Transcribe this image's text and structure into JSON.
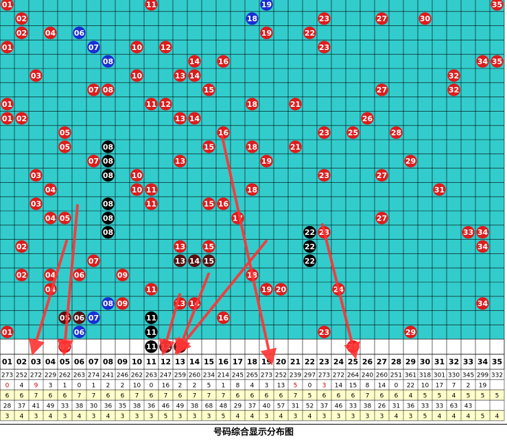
{
  "caption": "号码综合显示分布图",
  "colors": {
    "grid_bg": "#33cccc",
    "grid_line": "#000000",
    "hit_red": "#dd1c1c",
    "hit_blue": "#1a2fd0",
    "hit_black": "#000000",
    "hit_darkred": "#5a1010",
    "arrow": "#ff3333",
    "row_yellow": "#ffffcc",
    "row_white": "#ffffff"
  },
  "chart_data": {
    "type": "table",
    "columns": [
      "01",
      "02",
      "03",
      "04",
      "05",
      "06",
      "07",
      "08",
      "09",
      "10",
      "11",
      "12",
      "13",
      "14",
      "15",
      "16",
      "17",
      "18",
      "19",
      "20",
      "21",
      "22",
      "23",
      "24",
      "25",
      "26",
      "27",
      "28",
      "29",
      "30",
      "31",
      "32",
      "33",
      "34",
      "35"
    ],
    "hits": [
      [
        [
          1,
          "r"
        ],
        [
          11,
          "r"
        ],
        [
          19,
          "b"
        ],
        [
          35,
          "r"
        ]
      ],
      [
        [
          2,
          "r"
        ],
        [
          18,
          "b"
        ],
        [
          23,
          "r"
        ],
        [
          27,
          "r"
        ],
        [
          30,
          "r"
        ]
      ],
      [
        [
          2,
          "r"
        ],
        [
          4,
          "r"
        ],
        [
          6,
          "b"
        ],
        [
          19,
          "r"
        ],
        [
          22,
          "r"
        ]
      ],
      [
        [
          1,
          "r"
        ],
        [
          7,
          "b"
        ],
        [
          10,
          "r"
        ],
        [
          12,
          "r"
        ],
        [
          23,
          "r"
        ]
      ],
      [
        [
          8,
          "b"
        ],
        [
          14,
          "r"
        ],
        [
          16,
          "r"
        ],
        [
          34,
          "r"
        ],
        [
          35,
          "r"
        ]
      ],
      [
        [
          3,
          "r"
        ],
        [
          10,
          "r"
        ],
        [
          13,
          "r"
        ],
        [
          14,
          "r"
        ],
        [
          32,
          "r"
        ]
      ],
      [
        [
          7,
          "r"
        ],
        [
          8,
          "r"
        ],
        [
          15,
          "r"
        ],
        [
          27,
          "r"
        ],
        [
          32,
          "r"
        ]
      ],
      [
        [
          1,
          "r"
        ],
        [
          11,
          "r"
        ],
        [
          12,
          "r"
        ],
        [
          18,
          "r"
        ],
        [
          21,
          "r"
        ]
      ],
      [
        [
          1,
          "r"
        ],
        [
          2,
          "r"
        ],
        [
          13,
          "r"
        ],
        [
          14,
          "r"
        ],
        [
          26,
          "r"
        ]
      ],
      [
        [
          5,
          "r"
        ],
        [
          16,
          "r"
        ],
        [
          23,
          "r"
        ],
        [
          25,
          "r"
        ],
        [
          28,
          "r"
        ]
      ],
      [
        [
          5,
          "r"
        ],
        [
          8,
          "k"
        ],
        [
          15,
          "r"
        ],
        [
          18,
          "r"
        ],
        [
          21,
          "r"
        ]
      ],
      [
        [
          7,
          "r"
        ],
        [
          8,
          "k"
        ],
        [
          13,
          "r"
        ],
        [
          19,
          "r"
        ],
        [
          29,
          "r"
        ]
      ],
      [
        [
          3,
          "r"
        ],
        [
          8,
          "k"
        ],
        [
          10,
          "r"
        ],
        [
          23,
          "r"
        ],
        [
          27,
          "r"
        ]
      ],
      [
        [
          4,
          "r"
        ],
        [
          10,
          "r"
        ],
        [
          11,
          "r"
        ],
        [
          18,
          "r"
        ],
        [
          31,
          "r"
        ]
      ],
      [
        [
          3,
          "r"
        ],
        [
          8,
          "k"
        ],
        [
          11,
          "r"
        ],
        [
          15,
          "r"
        ],
        [
          16,
          "r"
        ]
      ],
      [
        [
          4,
          "r"
        ],
        [
          5,
          "r"
        ],
        [
          8,
          "k"
        ],
        [
          17,
          "r"
        ],
        [
          27,
          "r"
        ]
      ],
      [
        [
          8,
          "k"
        ],
        [
          22,
          "k"
        ],
        [
          23,
          "r"
        ],
        [
          33,
          "r"
        ],
        [
          34,
          "r"
        ]
      ],
      [
        [
          2,
          "r"
        ],
        [
          13,
          "r"
        ],
        [
          15,
          "r"
        ],
        [
          22,
          "k"
        ],
        [
          34,
          "r"
        ]
      ],
      [
        [
          7,
          "r"
        ],
        [
          13,
          "d"
        ],
        [
          14,
          "d"
        ],
        [
          15,
          "d"
        ],
        [
          22,
          "k"
        ]
      ],
      [
        [
          2,
          "r"
        ],
        [
          4,
          "r"
        ],
        [
          6,
          "r"
        ],
        [
          9,
          "r"
        ],
        [
          18,
          "r"
        ]
      ],
      [
        [
          4,
          "r"
        ],
        [
          11,
          "r"
        ],
        [
          19,
          "r"
        ],
        [
          20,
          "r"
        ],
        [
          24,
          "r"
        ]
      ],
      [
        [
          8,
          "b"
        ],
        [
          9,
          "r"
        ],
        [
          13,
          "r"
        ],
        [
          14,
          "r"
        ],
        [
          34,
          "r"
        ]
      ],
      [
        [
          5,
          "d"
        ],
        [
          6,
          "d"
        ],
        [
          7,
          "b"
        ],
        [
          11,
          "k"
        ],
        [
          16,
          "r"
        ]
      ],
      [
        [
          1,
          "r"
        ],
        [
          6,
          "b"
        ],
        [
          11,
          "k"
        ],
        [
          23,
          "r"
        ],
        [
          29,
          "r"
        ]
      ]
    ],
    "prediction_hits": [
      [
        5,
        "r"
      ],
      [
        11,
        "k"
      ],
      [
        12,
        "d"
      ],
      [
        13,
        "d"
      ],
      [
        25,
        "r"
      ]
    ],
    "stats_rows": [
      [
        "273",
        "252",
        "272",
        "229",
        "262",
        "263",
        "274",
        "241",
        "246",
        "262",
        "263",
        "247",
        "259",
        "260",
        "234",
        "214",
        "245",
        "265",
        "273",
        "252",
        "239",
        "297",
        "273",
        "272",
        "264",
        "240",
        "260",
        "251",
        "361",
        "318",
        "301",
        "330",
        "345",
        "299",
        "332"
      ],
      [
        "0",
        "4",
        "9",
        "3",
        "1",
        "0",
        "1",
        "2",
        "2",
        "10",
        "0",
        "16",
        "2",
        "2",
        "5",
        "1",
        "8",
        "4",
        "3",
        "13",
        "5",
        "0",
        "3",
        "14",
        "15",
        "8",
        "14",
        "0",
        "22",
        "10",
        "17",
        "7",
        "2",
        "19"
      ],
      [
        "6",
        "6",
        "7",
        "6",
        "6",
        "7",
        "7",
        "6",
        "6",
        "7",
        "6",
        "7",
        "6",
        "7",
        "7",
        "7",
        "6",
        "6",
        "6",
        "6",
        "7",
        "5",
        "6",
        "6",
        "6",
        "7",
        "6",
        "6",
        "4",
        "5",
        "5",
        "4",
        "5",
        "5",
        "5"
      ],
      [
        "28",
        "37",
        "41",
        "49",
        "33",
        "38",
        "30",
        "36",
        "35",
        "38",
        "36",
        "46",
        "49",
        "38",
        "68",
        "48",
        "29",
        "37",
        "40",
        "57",
        "31",
        "52",
        "37",
        "46",
        "33",
        "38",
        "26",
        "31",
        "36",
        "33",
        "33",
        "63",
        "43"
      ],
      [
        "3",
        "4",
        "3",
        "4",
        "3",
        "4",
        "3",
        "4",
        "3",
        "3",
        "3",
        "5",
        "3",
        "3",
        "3",
        "5",
        "4",
        "4",
        "3",
        "4",
        "3",
        "4",
        "3",
        "3",
        "3",
        "3",
        "3",
        "4",
        "3",
        "5",
        "4",
        "4",
        "4",
        "5",
        "4"
      ]
    ],
    "stats_row_colors": [
      "white",
      "white",
      "yellow",
      "white",
      "yellow"
    ],
    "arrows": [
      {
        "from": [
          97,
          352
        ],
        "to": [
          50,
          508
        ]
      },
      {
        "from": [
          113,
          300
        ],
        "to": [
          94,
          508
        ]
      },
      {
        "from": [
          262,
          430
        ],
        "to": [
          240,
          508
        ]
      },
      {
        "from": [
          304,
          400
        ],
        "to": [
          262,
          508
        ]
      },
      {
        "from": [
          388,
          352
        ],
        "to": [
          262,
          508
        ]
      },
      {
        "from": [
          324,
          200
        ],
        "to": [
          394,
          522
        ]
      },
      {
        "from": [
          470,
          328
        ],
        "to": [
          516,
          513
        ]
      }
    ]
  }
}
